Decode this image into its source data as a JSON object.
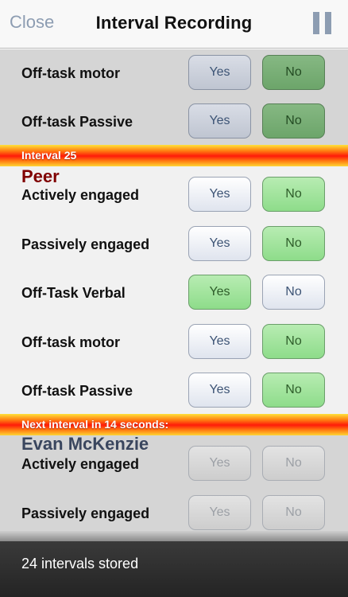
{
  "nav": {
    "close_label": "Close",
    "title": "Interval Recording"
  },
  "prev_section": {
    "rows": [
      {
        "label": "Off-task motor",
        "yes": "Yes",
        "no": "No",
        "selected": "no"
      },
      {
        "label": "Off-task Passive",
        "yes": "Yes",
        "no": "No",
        "selected": "no"
      }
    ]
  },
  "interval_banner": {
    "label": "Interval 25"
  },
  "current": {
    "student": "Peer",
    "rows": [
      {
        "label": "Actively engaged",
        "yes": "Yes",
        "no": "No",
        "selected": "no"
      },
      {
        "label": "Passively engaged",
        "yes": "Yes",
        "no": "No",
        "selected": "no"
      },
      {
        "label": "Off-Task Verbal",
        "yes": "Yes",
        "no": "No",
        "selected": "yes"
      },
      {
        "label": "Off-task motor",
        "yes": "Yes",
        "no": "No",
        "selected": "no"
      },
      {
        "label": "Off-task Passive",
        "yes": "Yes",
        "no": "No",
        "selected": "no"
      }
    ]
  },
  "next_banner": {
    "label": "Next interval in 14 seconds:"
  },
  "next": {
    "student": "Evan McKenzie",
    "rows": [
      {
        "label": "Actively engaged",
        "yes": "Yes",
        "no": "No"
      },
      {
        "label": "Passively engaged",
        "yes": "Yes",
        "no": "No"
      }
    ]
  },
  "status": {
    "text": "24 intervals stored"
  },
  "colors": {
    "accent": "#8d9db2",
    "selected_green": "#8edc8a",
    "banner_red": "#ff1a0a",
    "active_student": "#800000",
    "next_student": "#3a465e"
  },
  "icons": {
    "pause": "pause-icon"
  }
}
